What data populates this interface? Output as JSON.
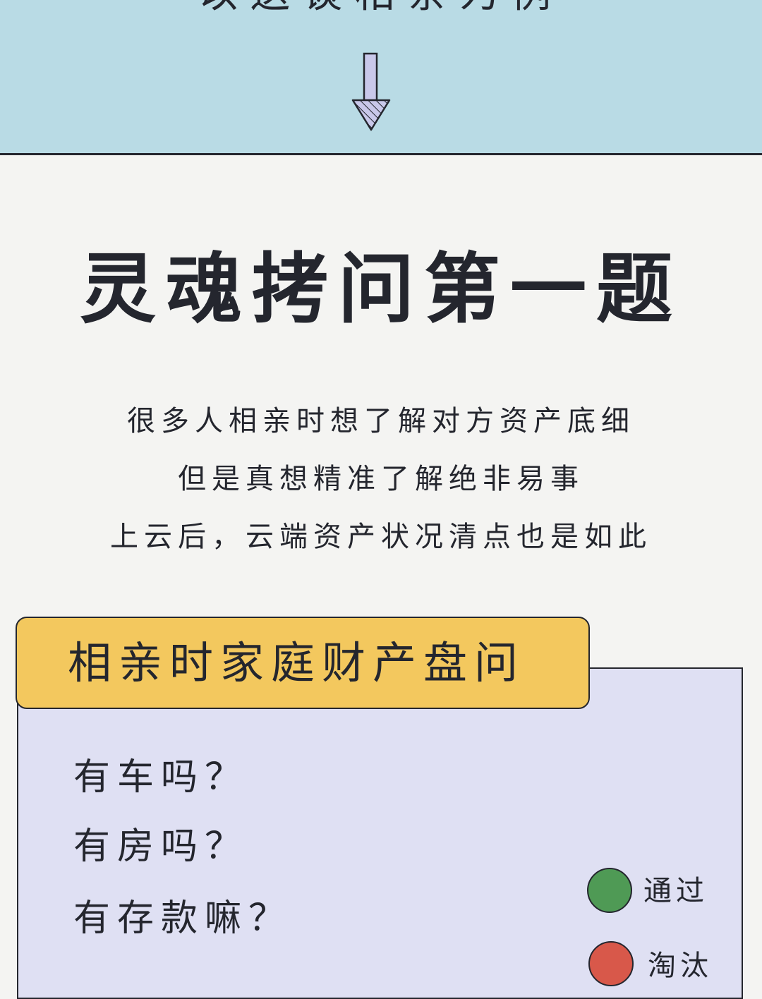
{
  "banner": {
    "title": "以送谈相亲为例",
    "arrow_icon": "down-arrow-icon"
  },
  "headline": {
    "title": "灵魂拷问第一题"
  },
  "intro": {
    "lines": [
      "很多人相亲时想了解对方资产底细",
      "但是真想精准了解绝非易事",
      "上云后，云端资产状况清点也是如此"
    ]
  },
  "card": {
    "tab_label": "相亲时家庭财产盘问",
    "questions": [
      "有车吗？",
      "有房吗？",
      "有存款嘛？"
    ],
    "legend": {
      "pass": {
        "label": "通过",
        "color": "#4f9a55"
      },
      "fail": {
        "label": "淘汰",
        "color": "#d8584a"
      }
    }
  },
  "colors": {
    "banner_bg": "#b9dbe5",
    "page_bg": "#f4f4f2",
    "card_bg": "#dfe0f3",
    "tab_bg": "#f3c85e",
    "ink": "#24262e",
    "arrow_fill": "#c9c8ea"
  }
}
